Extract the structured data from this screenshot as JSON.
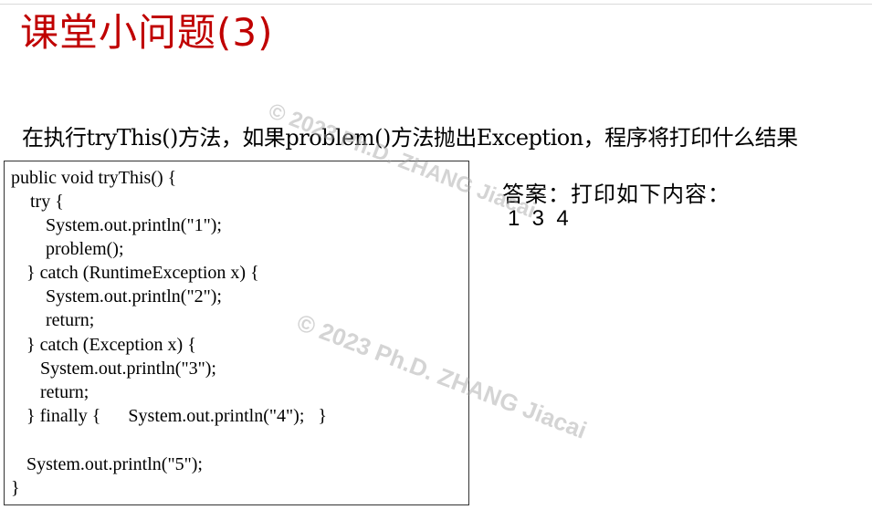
{
  "slide": {
    "title": "课堂小问题(3)",
    "question": "在执行tryThis()方法，如果problem()方法抛出Exception，程序将打印什么结果"
  },
  "code": {
    "lines": [
      "public void tryThis() {",
      "try {",
      "System.out.println(\"1\");",
      "problem();",
      "} catch (RuntimeException x) {",
      "System.out.println(\"2\");",
      "return;",
      "} catch (Exception x) {",
      "System.out.println(\"3\");",
      "return;",
      "} finally {      System.out.println(\"4\");   }",
      "System.out.println(\"5\");",
      "}"
    ]
  },
  "answer": {
    "label": "答案：打印如下内容：",
    "values": "1  3  4"
  },
  "watermarks": [
    "© 2023 Ph.D. ZHANG Jiacai",
    "© 2023 Ph.D. ZHANG Jiacai"
  ],
  "colors": {
    "title": "#c00000",
    "text": "#000000",
    "border": "#333333",
    "watermark": "#a0a0a0"
  }
}
